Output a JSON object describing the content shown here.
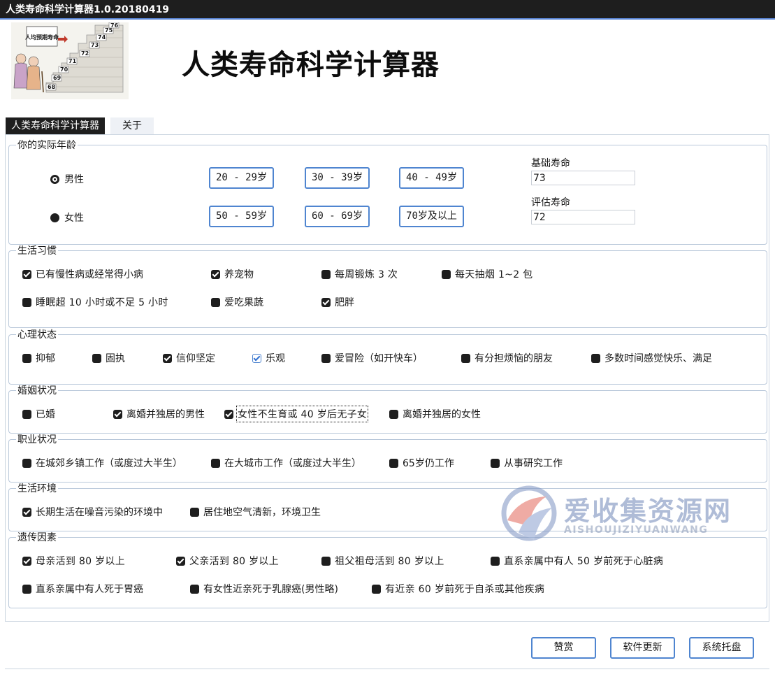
{
  "window": {
    "title": "人类寿命科学计算器1.0.20180419"
  },
  "header": {
    "title": "人类寿命科学计算器",
    "logo": {
      "caption": "人均预期寿命",
      "numbers": [
        "76",
        "75",
        "74",
        "73",
        "72",
        "71",
        "70",
        "69",
        "68"
      ]
    }
  },
  "tabs": [
    {
      "label": "人类寿命科学计算器",
      "active": true
    },
    {
      "label": "关于",
      "active": false
    }
  ],
  "age_group": {
    "title": "你的实际年龄",
    "gender_options": [
      {
        "label": "男性",
        "selected": true
      },
      {
        "label": "女性",
        "selected": false
      }
    ],
    "age_buttons": [
      "20 - 29岁",
      "30 - 39岁",
      "40 - 49岁",
      "50 - 59岁",
      "60 - 69岁",
      "70岁及以上"
    ],
    "base_life_label": "基础寿命",
    "base_life_value": "73",
    "estimated_life_label": "评估寿命",
    "estimated_life_value": "72"
  },
  "habits": {
    "title": "生活习惯",
    "items": [
      {
        "label": "已有慢性病或经常得小病",
        "checked": true
      },
      {
        "label": "养宠物",
        "checked": true
      },
      {
        "label": "每周锻炼 3 次",
        "checked": false
      },
      {
        "label": "每天抽烟 1~2 包",
        "checked": false
      },
      {
        "label": "睡眠超 10 小时或不足 5 小时",
        "checked": false
      },
      {
        "label": "爱吃果蔬",
        "checked": false
      },
      {
        "label": "肥胖",
        "checked": true
      }
    ]
  },
  "mental": {
    "title": "心理状态",
    "items": [
      {
        "label": "抑郁",
        "checked": false
      },
      {
        "label": "固执",
        "checked": false
      },
      {
        "label": "信仰坚定",
        "checked": true
      },
      {
        "label": "乐观",
        "checked": true
      },
      {
        "label": "爱冒险（如开快车）",
        "checked": false
      },
      {
        "label": "有分担烦恼的朋友",
        "checked": false
      },
      {
        "label": "多数时间感觉快乐、满足",
        "checked": false
      }
    ]
  },
  "marriage": {
    "title": "婚姻状况",
    "items": [
      {
        "label": "已婚",
        "checked": false
      },
      {
        "label": "离婚并独居的男性",
        "checked": true
      },
      {
        "label": "女性不生育或 40 岁后无子女",
        "checked": true
      },
      {
        "label": "离婚并独居的女性",
        "checked": false
      }
    ]
  },
  "career": {
    "title": "职业状况",
    "items": [
      {
        "label": "在城郊乡镇工作（或度过大半生）",
        "checked": false
      },
      {
        "label": "在大城市工作（或度过大半生）",
        "checked": false
      },
      {
        "label": "65岁仍工作",
        "checked": false
      },
      {
        "label": "从事研究工作",
        "checked": false
      }
    ]
  },
  "environment": {
    "title": "生活环境",
    "items": [
      {
        "label": "长期生活在噪音污染的环境中",
        "checked": true
      },
      {
        "label": "居住地空气清新，环境卫生",
        "checked": false
      }
    ]
  },
  "genetics": {
    "title": "遗传因素",
    "items": [
      {
        "label": "母亲活到 80 岁以上",
        "checked": true
      },
      {
        "label": "父亲活到 80 岁以上",
        "checked": true
      },
      {
        "label": "祖父祖母活到 80 岁以上",
        "checked": false
      },
      {
        "label": "直系亲属中有人 50 岁前死于心脏病",
        "checked": false
      },
      {
        "label": "直系亲属中有人死于胃癌",
        "checked": false
      },
      {
        "label": "有女性近亲死于乳腺癌(男性略)",
        "checked": false
      },
      {
        "label": "有近亲 60 岁前死于自杀或其他疾病",
        "checked": false
      }
    ]
  },
  "footer": {
    "buttons": [
      "赞赏",
      "软件更新",
      "系统托盘"
    ]
  },
  "watermark": {
    "main": "爱收集资源网",
    "sub": "AISHOUJIZIYUANWANG"
  },
  "colors": {
    "titlebar": "#1e1e1e",
    "accent": "#4f85d0",
    "group_border": "#b9c8da"
  }
}
